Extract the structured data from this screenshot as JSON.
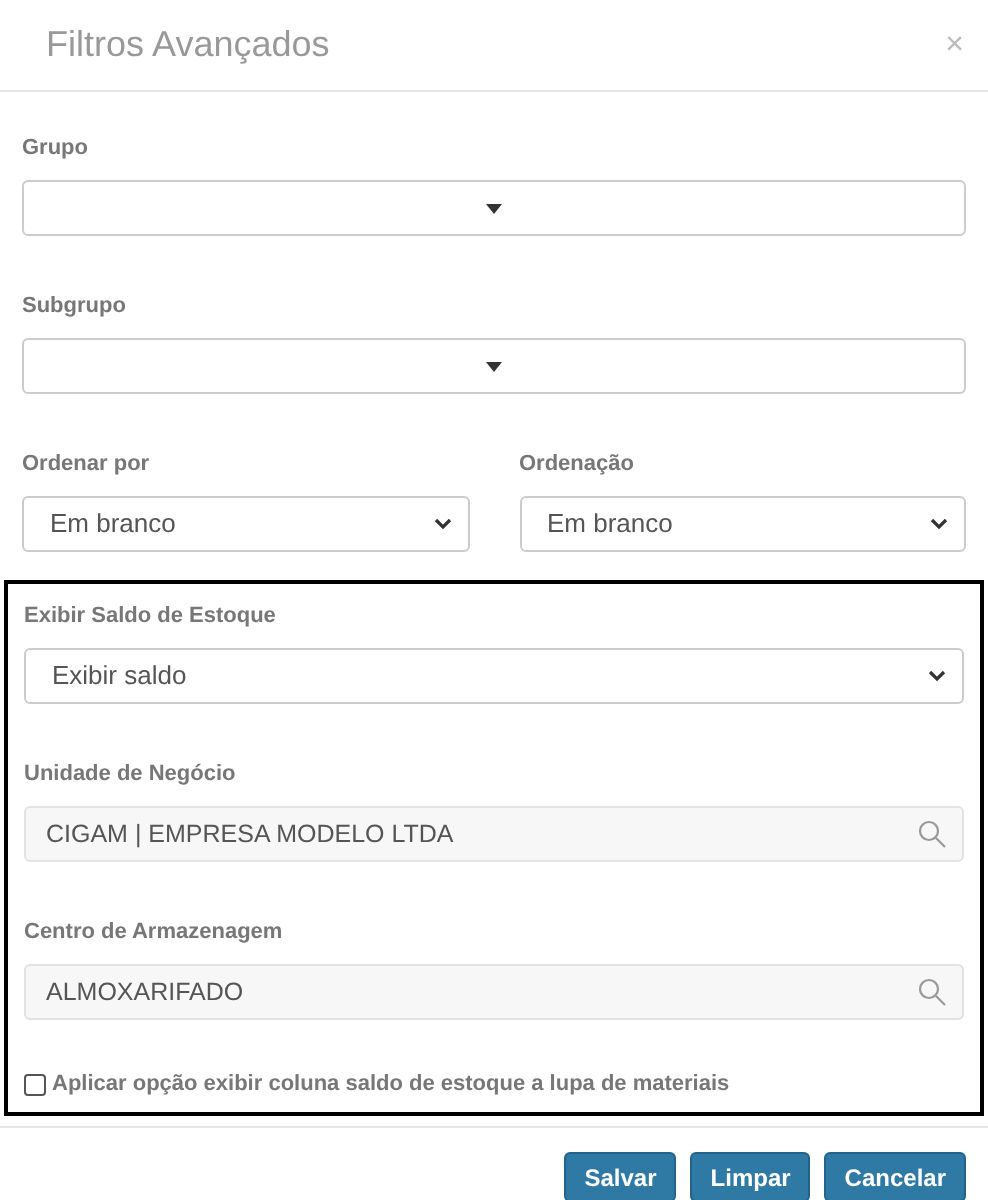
{
  "dialog": {
    "title": "Filtros Avançados",
    "close": "×"
  },
  "rows": [
    [
      {
        "label": "Grupo",
        "kind": "combo"
      }
    ],
    [
      {
        "label": "Subgrupo",
        "kind": "combo"
      }
    ],
    [
      {
        "label": "Ordenar por",
        "kind": "select",
        "value": "Em branco"
      },
      {
        "label": "Ordenação",
        "kind": "select",
        "value": "Em branco"
      }
    ]
  ],
  "section": {
    "highlighted": true,
    "fields": [
      {
        "label": "Exibir Saldo de Estoque",
        "kind": "select",
        "value": "Exibir saldo"
      },
      {
        "label": "Unidade de Negócio",
        "kind": "lookup",
        "value": "CIGAM | EMPRESA MODELO LTDA"
      },
      {
        "label": "Centro de Armazenagem",
        "kind": "lookup",
        "value": "ALMOXARIFADO"
      }
    ],
    "checkbox": {
      "label": "Aplicar opção exibir coluna saldo de estoque a lupa de materiais",
      "checked": false
    }
  },
  "buttons": [
    "Salvar",
    "Limpar",
    "Cancelar"
  ]
}
